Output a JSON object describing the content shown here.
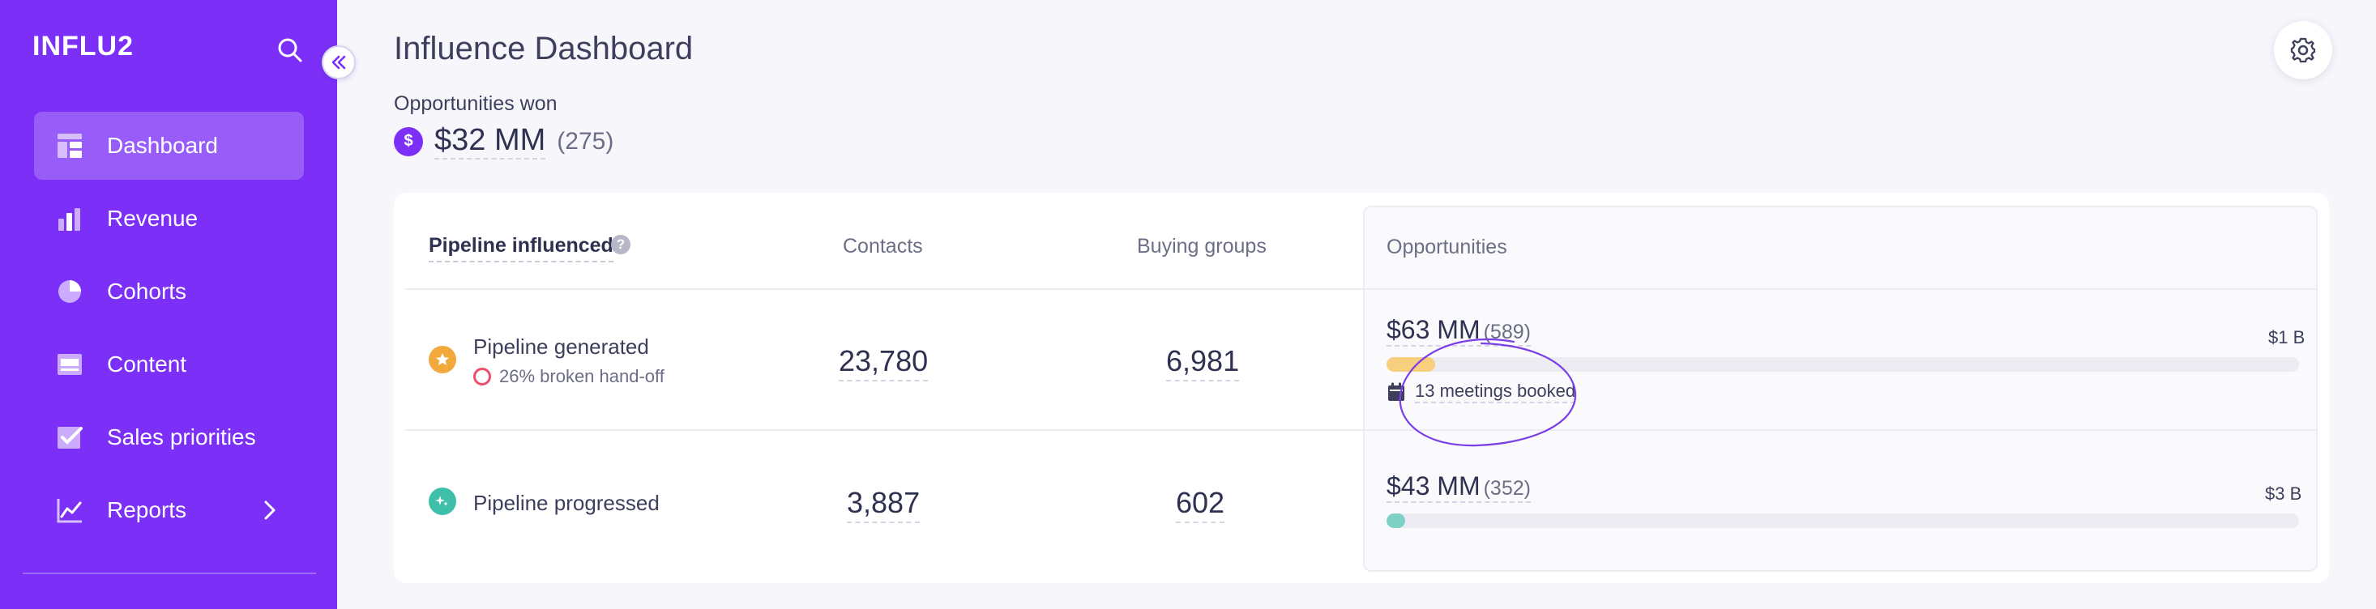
{
  "sidebar": {
    "brand": "INFLU2",
    "items": [
      {
        "label": "Dashboard",
        "icon": "dashboard-icon",
        "active": true
      },
      {
        "label": "Revenue",
        "icon": "bar-chart-icon"
      },
      {
        "label": "Cohorts",
        "icon": "pie-chart-icon"
      },
      {
        "label": "Content",
        "icon": "content-icon"
      },
      {
        "label": "Sales priorities",
        "icon": "checkbox-icon"
      },
      {
        "label": "Reports",
        "icon": "line-chart-icon",
        "has_submenu": true
      }
    ]
  },
  "header": {
    "title": "Influence Dashboard",
    "won_label": "Opportunities won",
    "won_badge": "$",
    "won_amount": "$32 MM",
    "won_count": "(275)"
  },
  "table": {
    "columns": {
      "pipeline": "Pipeline influenced",
      "help": "?",
      "contacts": "Contacts",
      "buying_groups": "Buying groups",
      "opportunities": "Opportunities"
    },
    "rows": [
      {
        "title": "Pipeline generated",
        "subtitle": "26% broken hand-off",
        "contacts": "23,780",
        "buying_groups": "6,981",
        "opp_amount": "$63 MM",
        "opp_count": "(589)",
        "opp_max": "$1 B",
        "progress": 0.053,
        "bar_color": "#f7cf7e",
        "meetings": "13 meetings booked",
        "icon_color": "#f2a93b"
      },
      {
        "title": "Pipeline progressed",
        "contacts": "3,887",
        "buying_groups": "602",
        "opp_amount": "$43 MM",
        "opp_count": "(352)",
        "opp_max": "$3 B",
        "progress": 0.02,
        "bar_color": "#7ed1c6",
        "icon_color": "#3dbfa9"
      }
    ]
  },
  "colors": {
    "accent": "#7b2ff7",
    "warning_ring": "#ef4d6b"
  }
}
